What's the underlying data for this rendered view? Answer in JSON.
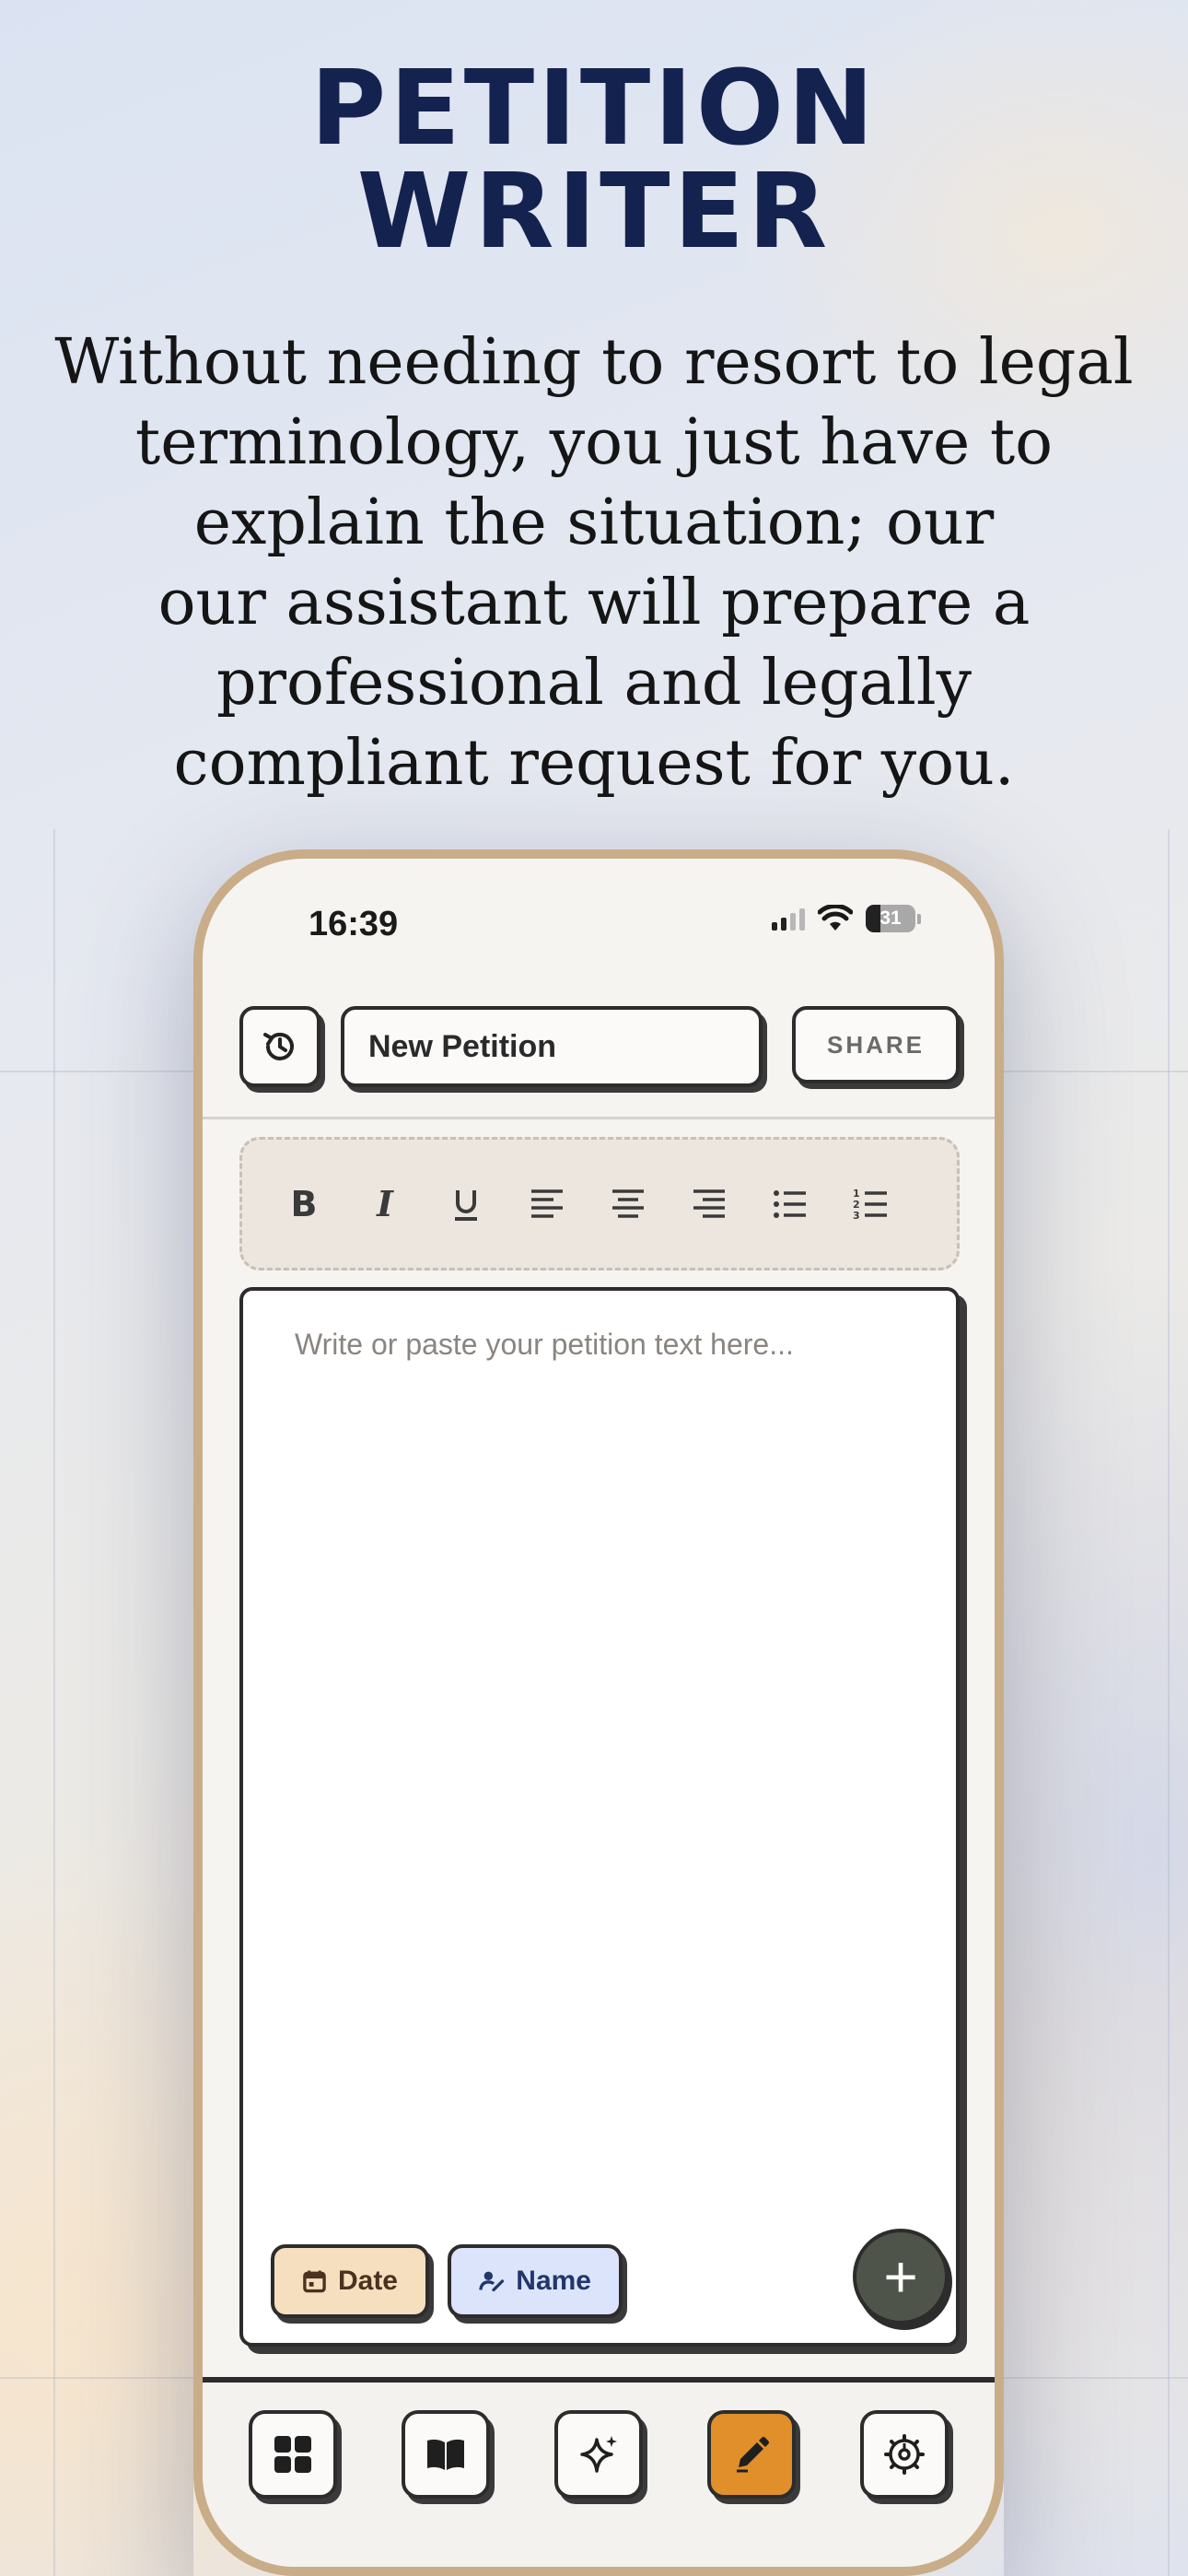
{
  "hero": {
    "title_line1": "PETITION",
    "title_line2": "WRITER",
    "description_lines": [
      "Without needing to resort to legal",
      "terminology, you just have to",
      "explain the situation; our",
      "our assistant will prepare a",
      "professional and legally",
      "compliant request for you."
    ]
  },
  "status_bar": {
    "time": "16:39",
    "battery": "31"
  },
  "topbar": {
    "history_icon": "history-icon",
    "title_value": "New Petition",
    "share_label": "SHARE"
  },
  "format_toolbar": {
    "items": [
      "bold",
      "italic",
      "underline",
      "align-left",
      "align-center",
      "align-right",
      "bullet-list",
      "numbered-list"
    ]
  },
  "editor": {
    "placeholder": "Write or paste your petition text here...",
    "chips": [
      {
        "label": "Date",
        "icon": "calendar-icon"
      },
      {
        "label": "Name",
        "icon": "signature-icon"
      }
    ],
    "fab_label": "+"
  },
  "bottom_nav": {
    "items": [
      {
        "icon": "grid-icon",
        "active": false
      },
      {
        "icon": "book-icon",
        "active": false
      },
      {
        "icon": "sparkle-icon",
        "active": false
      },
      {
        "icon": "pen-icon",
        "active": true
      },
      {
        "icon": "settings-icon",
        "active": false
      }
    ]
  },
  "colors": {
    "title": "#14224f",
    "accent": "#e08f2a",
    "phone_frame": "#c9ad88",
    "chip_date": "#f6dfbf",
    "chip_name": "#dbe4fb"
  }
}
